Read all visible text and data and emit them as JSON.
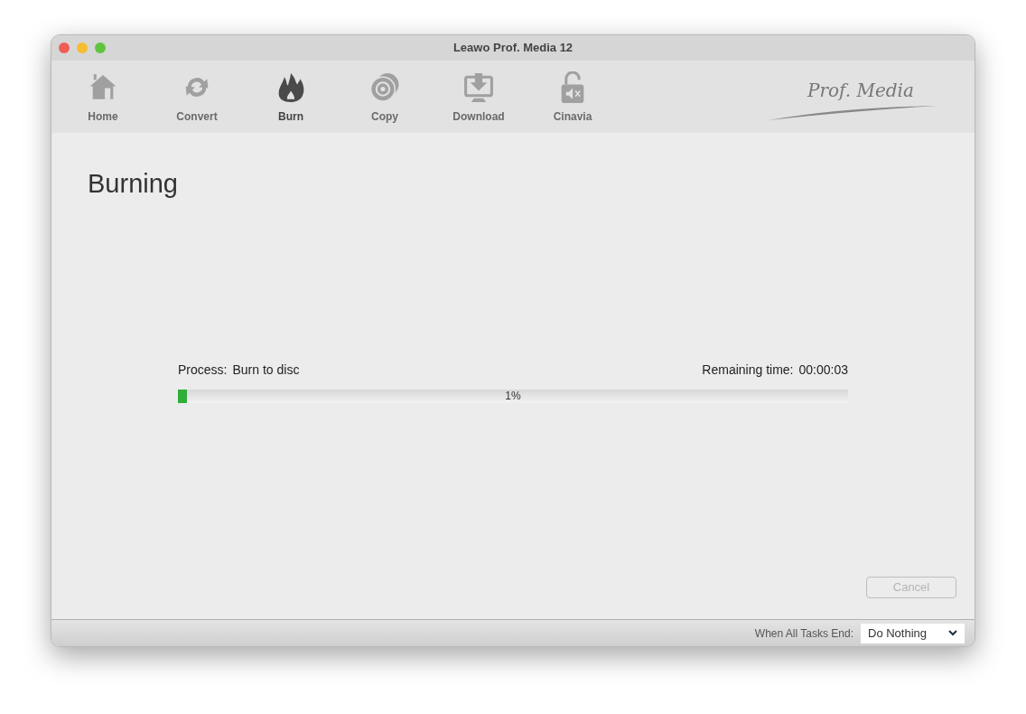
{
  "window": {
    "title": "Leawo Prof. Media 12"
  },
  "toolbar": [
    {
      "label": "Home",
      "selected": false
    },
    {
      "label": "Convert",
      "selected": false
    },
    {
      "label": "Burn",
      "selected": true
    },
    {
      "label": "Copy",
      "selected": false
    },
    {
      "label": "Download",
      "selected": false
    },
    {
      "label": "Cinavia",
      "selected": false
    }
  ],
  "logo": "Prof. Media",
  "heading": "Burning",
  "progress": {
    "process_label": "Process:",
    "process_value": "Burn to disc",
    "remaining_label": "Remaining time:",
    "remaining_value": "00:00:03",
    "level": 0.014,
    "percent": "1%"
  },
  "cancel_button": {
    "label": "Cancel",
    "disabled": true
  },
  "status_bar": {
    "label": "When All Tasks End:",
    "dropdown_value": "Do Nothing"
  }
}
